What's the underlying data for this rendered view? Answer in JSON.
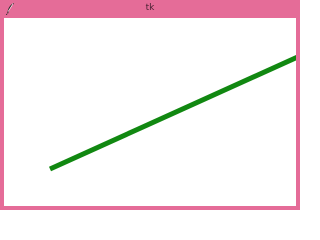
{
  "window": {
    "title": "tk",
    "frame_color": "#e56c98"
  },
  "title_icon": "feather-icon",
  "canvas": {
    "background": "#ffffff",
    "line": {
      "color": "#118811"
    }
  }
}
